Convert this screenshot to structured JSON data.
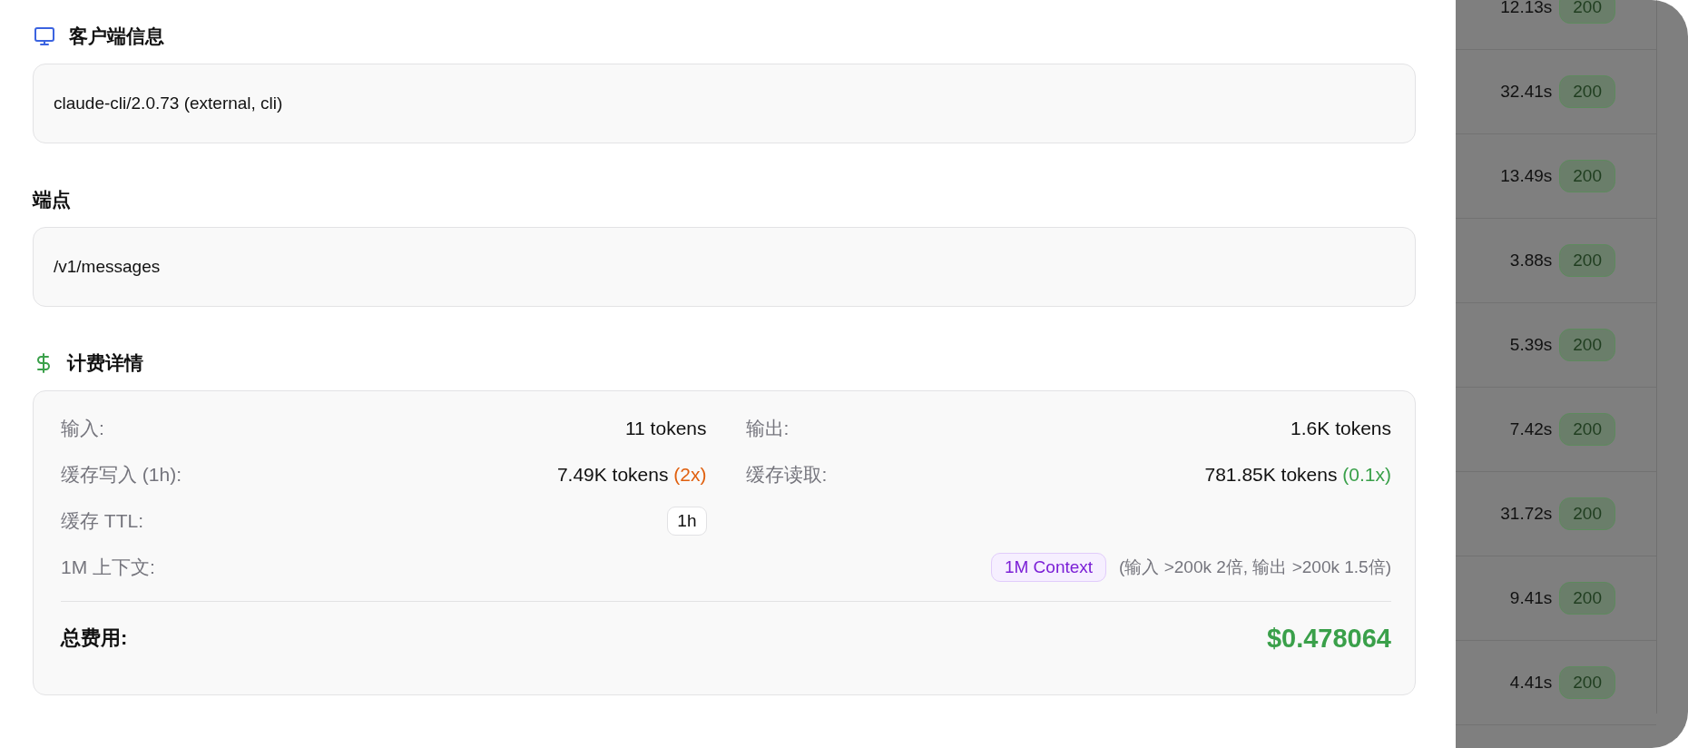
{
  "client": {
    "title": "客户端信息",
    "value": "claude-cli/2.0.73 (external, cli)"
  },
  "endpoint": {
    "title": "端点",
    "value": "/v1/messages"
  },
  "billing": {
    "title": "计费详情",
    "items": [
      {
        "kind": "tokens",
        "label": "输入:",
        "value": "11 tokens"
      },
      {
        "kind": "tokens",
        "label": "输出:",
        "value": "1.6K tokens"
      },
      {
        "kind": "tokens",
        "label": "缓存写入 (1h):",
        "value": "7.49K tokens",
        "multiplier": "(2x)",
        "color": "#e0600f"
      },
      {
        "kind": "tokens",
        "label": "缓存读取:",
        "value": "781.85K tokens",
        "multiplier": "(0.1x)",
        "color": "#3aa04a"
      },
      {
        "kind": "badge",
        "label": "缓存 TTL:",
        "badge": "1h"
      },
      {
        "kind": "blank"
      },
      {
        "kind": "context",
        "label": "1M 上下文:",
        "badge": "1M Context",
        "note": "(输入 >200k 2倍, 输出 >200k 1.5倍)"
      }
    ],
    "total_label": "总费用:",
    "total": "$0.478064"
  },
  "background_rows": [
    {
      "duration": "12.13s",
      "status": "200"
    },
    {
      "duration": "32.41s",
      "status": "200"
    },
    {
      "duration": "13.49s",
      "status": "200"
    },
    {
      "duration": "3.88s",
      "status": "200"
    },
    {
      "duration": "5.39s",
      "status": "200"
    },
    {
      "duration": "7.42s",
      "status": "200"
    },
    {
      "duration": "31.72s",
      "status": "200"
    },
    {
      "duration": "9.41s",
      "status": "200"
    },
    {
      "duration": "4.41s",
      "status": "200"
    }
  ]
}
